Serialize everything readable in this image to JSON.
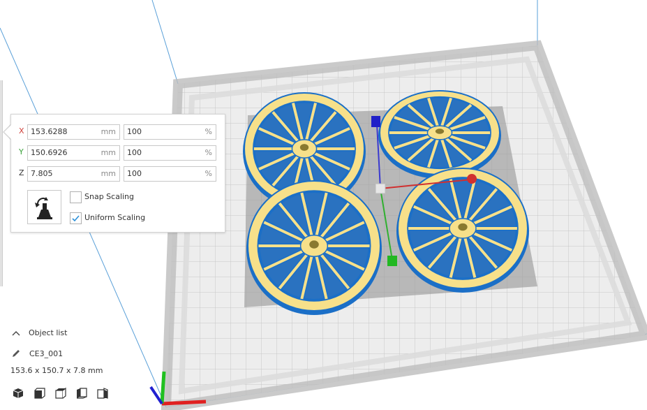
{
  "transform": {
    "x": {
      "axis": "X",
      "value": "153.6288",
      "unit": "mm",
      "scale": "100",
      "scale_unit": "%",
      "color": "#d0403a"
    },
    "y": {
      "axis": "Y",
      "value": "150.6926",
      "unit": "mm",
      "scale": "100",
      "scale_unit": "%",
      "color": "#3aa13a"
    },
    "z": {
      "axis": "Z",
      "value": "7.805",
      "unit": "mm",
      "scale": "100",
      "scale_unit": "%",
      "color": "#333333"
    }
  },
  "options": {
    "snap_scaling": {
      "label": "Snap Scaling",
      "checked": false
    },
    "uniform_scaling": {
      "label": "Uniform Scaling",
      "checked": true
    }
  },
  "tool_icon": "lock-scale-icon",
  "object_list": {
    "label": "Object list",
    "object_name": "CE3_001",
    "dimensions": "153.6 x 150.7 x 7.8 mm"
  },
  "view_buttons": [
    "3d-view-icon",
    "front-view-icon",
    "top-view-icon",
    "left-view-icon",
    "right-view-icon"
  ],
  "colors": {
    "accent": "#2a8fd8",
    "model_fill": "#f7e08a",
    "model_outline": "#1b6fc7",
    "build_plate": "#c4c4c4"
  }
}
